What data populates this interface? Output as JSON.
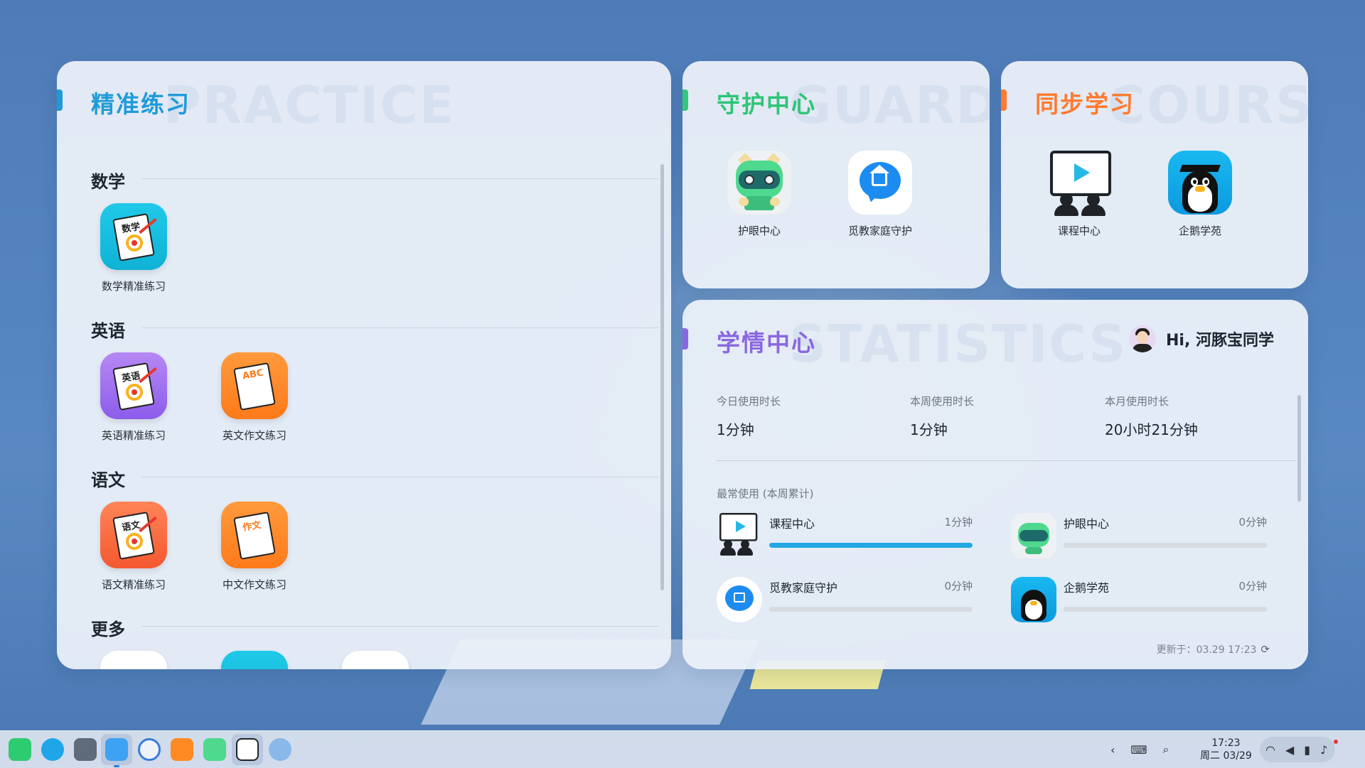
{
  "practice": {
    "title": "精准练习",
    "watermark": "PRACTICE",
    "accent": "#1f9bd9",
    "sections": [
      {
        "title": "数学",
        "apps": [
          {
            "label": "数学精准练习",
            "icon": "math-practice-icon",
            "badge": "数学"
          }
        ]
      },
      {
        "title": "英语",
        "apps": [
          {
            "label": "英语精准练习",
            "icon": "english-practice-icon",
            "badge": "英语"
          },
          {
            "label": "英文作文练习",
            "icon": "english-composition-icon",
            "badge": "ABC"
          }
        ]
      },
      {
        "title": "语文",
        "apps": [
          {
            "label": "语文精准练习",
            "icon": "chinese-practice-icon",
            "badge": "语文"
          },
          {
            "label": "中文作文练习",
            "icon": "chinese-composition-icon",
            "badge": "作文"
          }
        ]
      },
      {
        "title": "更多",
        "apps": []
      }
    ]
  },
  "guard": {
    "title": "守护中心",
    "watermark": "GUARDS",
    "accent": "#34c77b",
    "apps": [
      {
        "label": "护眼中心",
        "icon": "eye-care-robot-icon"
      },
      {
        "label": "觅教家庭守护",
        "icon": "family-guard-icon"
      }
    ]
  },
  "sync": {
    "title": "同步学习",
    "watermark": "COURSE",
    "accent": "#ff7a2f",
    "apps": [
      {
        "label": "课程中心",
        "icon": "course-center-icon"
      },
      {
        "label": "企鹅学苑",
        "icon": "penguin-academy-icon"
      }
    ]
  },
  "stats": {
    "title": "学情中心",
    "watermark": "STATISTICS",
    "accent": "#8a67e0",
    "greeting": "Hi, 河豚宝同学",
    "usage": [
      {
        "label": "今日使用时长",
        "value": "1分钟"
      },
      {
        "label": "本周使用时长",
        "value": "1分钟"
      },
      {
        "label": "本月使用时长",
        "value": "20小时21分钟"
      }
    ],
    "frequent_title": "最常使用 (本周累计)",
    "frequent": [
      {
        "name": "课程中心",
        "time": "1分钟",
        "progress": 1.0,
        "icon": "course-center-icon"
      },
      {
        "name": "护眼中心",
        "time": "0分钟",
        "progress": 0.0,
        "icon": "eye-care-robot-icon"
      },
      {
        "name": "觅教家庭守护",
        "time": "0分钟",
        "progress": 0.0,
        "icon": "family-guard-icon"
      },
      {
        "name": "企鹅学苑",
        "time": "0分钟",
        "progress": 0.0,
        "icon": "penguin-academy-icon"
      }
    ],
    "updated": "更新于：03.29 17:23"
  },
  "taskbar": {
    "apps": [
      "launcher-icon",
      "app-store-icon",
      "multitask-icon",
      "file-manager-icon",
      "browser-icon",
      "practice-app-icon",
      "eye-care-robot-icon",
      "course-center-icon",
      "settings-icon"
    ],
    "time": "17:23",
    "date": "周二 03/29"
  }
}
